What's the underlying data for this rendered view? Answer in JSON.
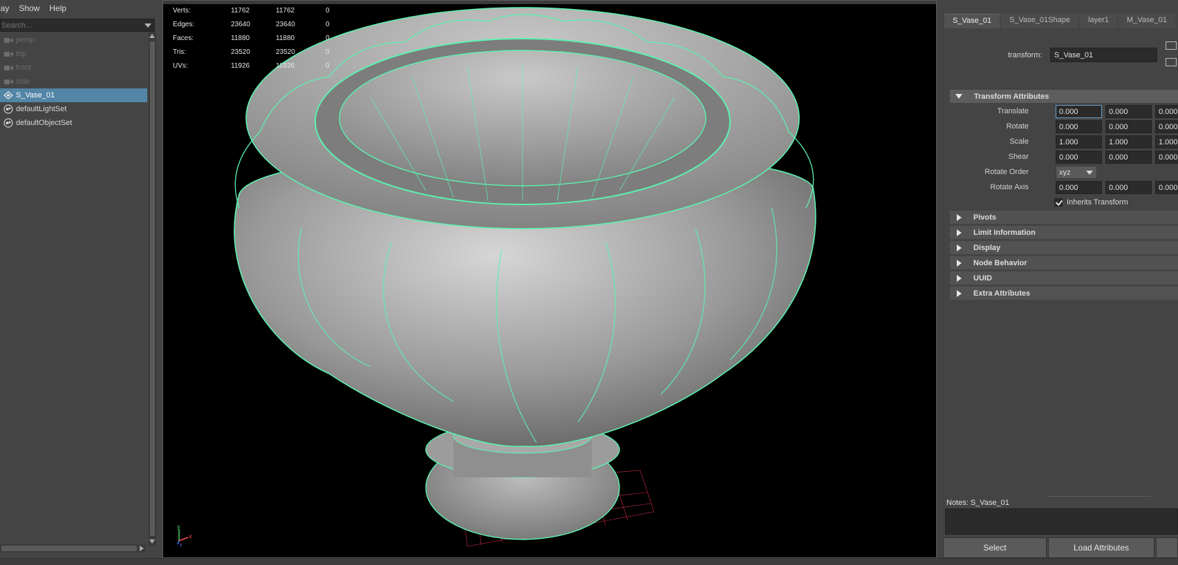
{
  "menubar": {
    "items": [
      "lay",
      "Show",
      "Help"
    ]
  },
  "outliner": {
    "search_placeholder": "Search...",
    "items": [
      {
        "label": "persp",
        "icon": "camera-icon",
        "dim": true
      },
      {
        "label": "top",
        "icon": "camera-icon",
        "dim": true
      },
      {
        "label": "front",
        "icon": "camera-icon",
        "dim": true
      },
      {
        "label": "side",
        "icon": "camera-icon",
        "dim": true
      },
      {
        "label": "S_Vase_01",
        "icon": "transform-icon",
        "selected": true
      },
      {
        "label": "defaultLightSet",
        "icon": "set-icon"
      },
      {
        "label": "defaultObjectSet",
        "icon": "set-icon"
      }
    ]
  },
  "hud": {
    "rows": [
      {
        "label": "Verts:",
        "v1": "11762",
        "v2": "11762",
        "v3": "0"
      },
      {
        "label": "Edges:",
        "v1": "23640",
        "v2": "23640",
        "v3": "0"
      },
      {
        "label": "Faces:",
        "v1": "11880",
        "v2": "11880",
        "v3": "0"
      },
      {
        "label": "Tris:",
        "v1": "23520",
        "v2": "23520",
        "v3": "0"
      },
      {
        "label": "UVs:",
        "v1": "11926",
        "v2": "11926",
        "v3": "0"
      }
    ]
  },
  "axis": {
    "y": "y",
    "x": "x",
    "z": "z"
  },
  "attribute_editor": {
    "tabs": [
      "S_Vase_01",
      "S_Vase_01Shape",
      "layer1",
      "M_Vase_01"
    ],
    "transform_label": "transform:",
    "transform_value": "S_Vase_01",
    "section_open": "Transform Attributes",
    "translate": {
      "label": "Translate",
      "values": [
        "0.000",
        "0.000",
        "0.000"
      ]
    },
    "rotate": {
      "label": "Rotate",
      "values": [
        "0.000",
        "0.000",
        "0.000"
      ]
    },
    "scale": {
      "label": "Scale",
      "values": [
        "1.000",
        "1.000",
        "1.000"
      ]
    },
    "shear": {
      "label": "Shear",
      "values": [
        "0.000",
        "0.000",
        "0.000"
      ]
    },
    "rotate_order": {
      "label": "Rotate Order",
      "value": "xyz"
    },
    "rotate_axis": {
      "label": "Rotate Axis",
      "values": [
        "0.000",
        "0.000",
        "0.000"
      ]
    },
    "inherits_transform": {
      "label": "Inherits Transform",
      "checked": true
    },
    "sections_closed": [
      "Pivots",
      "Limit Information",
      "Display",
      "Node Behavior",
      "UUID",
      "Extra Attributes"
    ],
    "notes_label": "Notes:  S_Vase_01",
    "buttons": {
      "select": "Select",
      "load_attributes": "Load Attributes"
    }
  },
  "colors": {
    "wire": "#5cf2b0",
    "selection": "#5285a6"
  }
}
